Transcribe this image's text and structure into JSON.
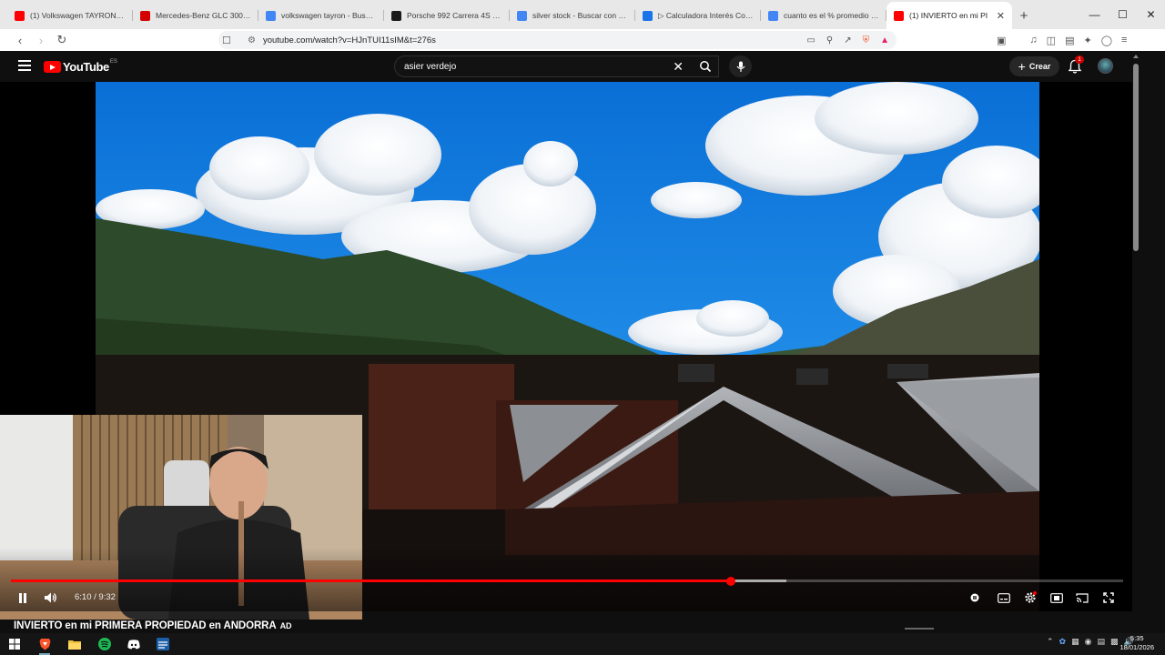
{
  "browser": {
    "tabs": [
      {
        "title": "(1) Volkswagen TAYRON: Un tr",
        "favicon": "youtube-icon",
        "color": "#ff0000"
      },
      {
        "title": "Mercedes-Benz GLC 300 de",
        "favicon": "brand-icon",
        "color": "#d40000"
      },
      {
        "title": "volkswagen tayron - Buscar c",
        "favicon": "google-icon",
        "color": "#4285f4"
      },
      {
        "title": "Porsche 992 Carrera 4S Mkl",
        "favicon": "site-icon",
        "color": "#1a1a1a"
      },
      {
        "title": "silver stock - Buscar con Goo",
        "favicon": "google-icon",
        "color": "#4285f4"
      },
      {
        "title": "▷ Calculadora Interés Compu",
        "favicon": "pen-icon",
        "color": "#1a73e8"
      },
      {
        "title": "cuanto es el % promedio que",
        "favicon": "google-icon",
        "color": "#4285f4"
      },
      {
        "title": "(1) INVIERTO en mi PI",
        "favicon": "youtube-icon",
        "color": "#ff0000",
        "active": true
      }
    ],
    "url": "youtube.com/watch?v=HJnTUI11sIM&t=276s"
  },
  "youtube": {
    "logo_text": "YouTube",
    "region_code": "ES",
    "search_value": "asier verdejo",
    "create_label": "Crear",
    "notification_count": "1"
  },
  "player": {
    "current_time": "6:10",
    "separator": " / ",
    "duration": "9:32",
    "progress_played": 0.6469,
    "progress_buffered": 0.697,
    "accent_color": "#ff0000"
  },
  "video": {
    "title": "INVIERTO en mi PRIMERA PROPIEDAD en ANDORRA",
    "badge": "AD"
  },
  "taskbar": {
    "time": "5:35",
    "date": "18/01/2026"
  }
}
